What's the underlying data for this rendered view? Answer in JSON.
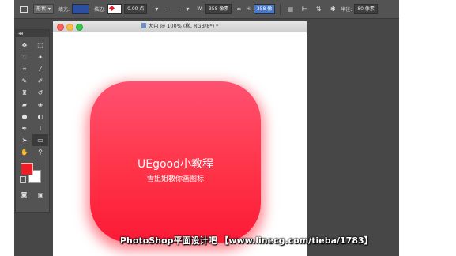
{
  "options_bar": {
    "mode": "形状",
    "fill_label": "填充:",
    "fill_color": "#2d4fa1",
    "stroke_label": "描边:",
    "stroke_width": "0.00 点",
    "width_label": "W:",
    "width_value": "358 像素",
    "height_label": "H:",
    "height_value": "358 像",
    "radius_label": "半径:",
    "radius_value": "80 像素"
  },
  "toolbox": {
    "collapse": "◂◂",
    "foreground_color": "#ee1c24",
    "background_color": "#ffffff"
  },
  "document": {
    "title": "大白 @ 100% (椭, RGB/8*) *",
    "icon_title": "UEgood小教程",
    "icon_subtitle": "雪姐姐教你画图标",
    "icon_color_top": "#ff5171",
    "icon_color_bottom": "#fb1a36"
  },
  "watermark": "PhotoShop平面设计吧 【www.linecg.com/tieba/1783】"
}
